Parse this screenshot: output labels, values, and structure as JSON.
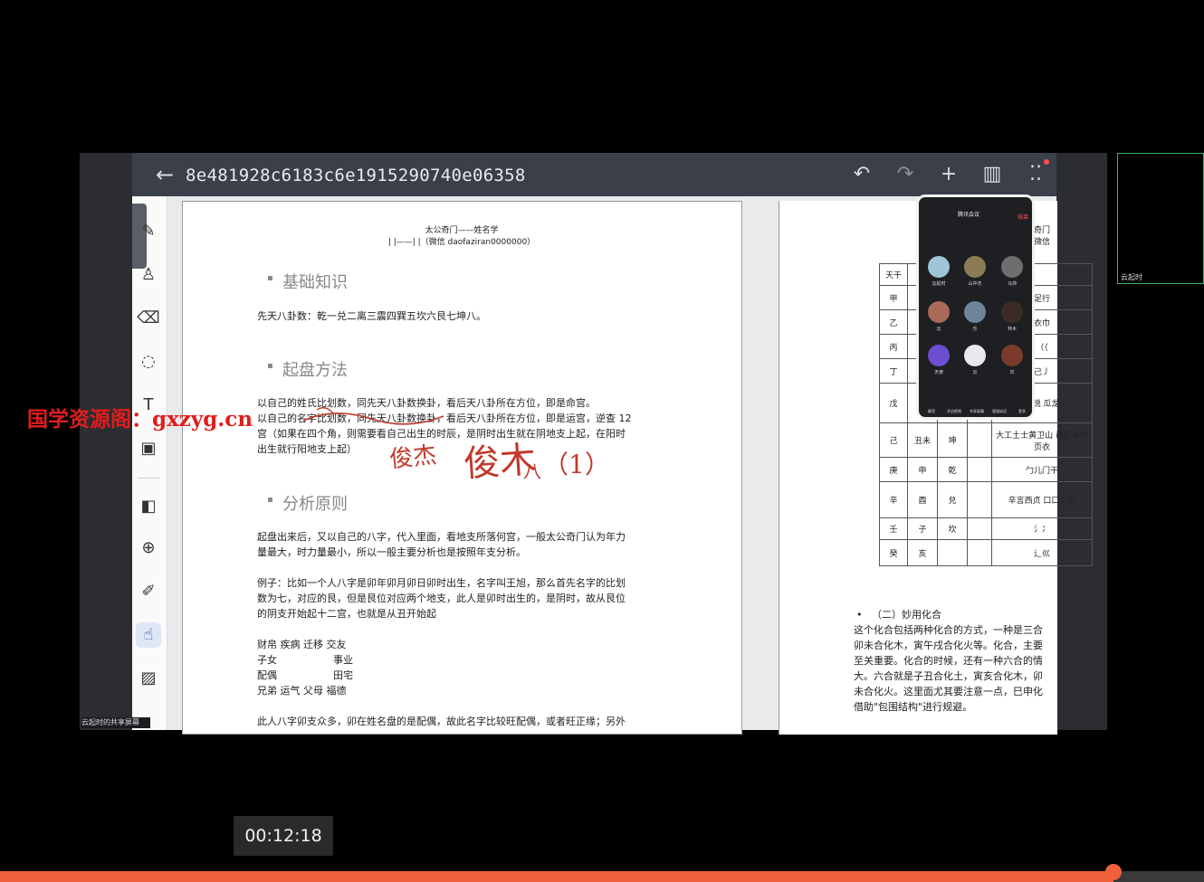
{
  "topbar": {
    "back_icon": "arrow-left-icon",
    "title": "8e481928c6183c6e1915290740e06358",
    "undo": "↶",
    "redo": "↷",
    "add": "+",
    "split": "▥",
    "more": "⁚⁚"
  },
  "tools": [
    {
      "name": "pen-tool",
      "glyph": "✎"
    },
    {
      "name": "highlighter-tool",
      "glyph": "♙"
    },
    {
      "name": "eraser-tool",
      "glyph": "⌫"
    },
    {
      "name": "lasso-tool",
      "glyph": "◌"
    },
    {
      "name": "text-tool",
      "glyph": "T"
    },
    {
      "name": "image-tool",
      "glyph": "▣"
    },
    {
      "name": "shape-tool",
      "glyph": "◧"
    },
    {
      "name": "zoom-tool",
      "glyph": "⊕"
    },
    {
      "name": "laser-tool",
      "glyph": "✐"
    },
    {
      "name": "hand-tool",
      "glyph": "☝"
    },
    {
      "name": "pattern-tool",
      "glyph": "▨"
    }
  ],
  "share_label": "云起时的共享屏幕",
  "watermark": "国学资源阁：gxzyg.cn",
  "page1": {
    "header_line1": "太公奇门——姓名学",
    "header_line2": "| |——| |（微信 daofaziran0000000）",
    "sections": [
      {
        "title": "基础知识"
      },
      {
        "title": "起盘方法"
      },
      {
        "title": "分析原则"
      }
    ],
    "p_basic": "先天八卦数：乾一兑二离三震四巽五坎六艮七坤八。",
    "p_method_1": "以自己的姓氏比划数，同先天八卦数换卦，看后天八卦所在方位，即是命宫。",
    "p_method_2": "以自己的名字比划数，同先天八卦数换卦，看后天八卦所在方位，即是运宫，逆查 12",
    "p_method_3": "宫（如果在四个角，则需要看自己出生的时辰，是阴时出生就在阴地支上起，在阳时",
    "p_method_4": "出生就行阳地支上起）",
    "p_analysis_1": "起盘出来后，又以自己的八字，代入里面，看地支所落何宫，一般太公奇门认为年力",
    "p_analysis_2": "量最大，时力量最小，所以一般主要分析也是按照年支分析。",
    "p_example_1": "例子：比如一个人八字是卯年卯月卯日卯时出生，名字叫王旭，那么首先名字的比划",
    "p_example_2": "数为七，对应的艮，但是艮位对应两个地支，此人是卯时出生的，是阴时，故从艮位",
    "p_example_3": "的阴支开始起十二宫，也就是从丑开始起",
    "palace_1": "财帛 疾病 迁移 交友",
    "palace_2a": "子女",
    "palace_2b": "事业",
    "palace_3a": "配偶",
    "palace_3b": "田宅",
    "palace_4": "兄弟 运气 父母 福德",
    "p_last": "此人八字卯支众多，卯在姓名盘的是配偶，故此名字比较旺配偶，或者旺正缘；另外",
    "ink_1": "俊杰",
    "ink_2": "俊木",
    "ink_3": "八",
    "ink_4": "（1）"
  },
  "page2": {
    "header_partial_1": "奇门",
    "header_partial_2": "微信",
    "table": [
      [
        "天干",
        "",
        "",
        "",
        ""
      ],
      [
        "甲",
        "",
        "",
        "",
        "足行"
      ],
      [
        "乙",
        "",
        "",
        "",
        "衣巾"
      ],
      [
        "丙",
        "",
        "",
        "",
        "（（"
      ],
      [
        "丁",
        "",
        "",
        "",
        "己丿"
      ],
      [
        "戊",
        "",
        "",
        "",
        "采锐 瓜龙"
      ],
      [
        "己",
        "丑未",
        "坤",
        "",
        "大工土士黄卫山 邑臣米肉页衣"
      ],
      [
        "庚",
        "申",
        "乾",
        "",
        "勹儿门干"
      ],
      [
        "辛",
        "酉",
        "兑",
        "",
        "辛言西贞 口口讠夕"
      ],
      [
        "壬",
        "子",
        "坎",
        "",
        "氵冫"
      ],
      [
        "癸",
        "亥",
        "",
        "",
        "辶巛"
      ]
    ],
    "sub_title": "（二）妙用化合",
    "lines": [
      "这个化合包括两种化合的方式，一种是三合",
      "卯未合化木，寅午戌合化火等。化合，主要",
      "至关重要。化合的时候，还有一种六合的情",
      "大。六合就是子丑合化土，寅亥合化木，卯",
      "未合化火。这里面尤其要注意一点，巳申化",
      "借助\"包围结构\"进行规避。"
    ]
  },
  "phone": {
    "title": "腾讯会议",
    "end": "结束",
    "participants": [
      "云起时",
      "山中杰",
      "马帅",
      "云",
      "乐",
      "林木",
      "天使",
      "云",
      "刘"
    ],
    "footer": [
      "静音",
      "开启视频",
      "共享屏幕",
      "管理成员",
      "更多"
    ]
  },
  "thumb_label": "云起时",
  "timestamp": "00:12:18",
  "progress": 0.925
}
